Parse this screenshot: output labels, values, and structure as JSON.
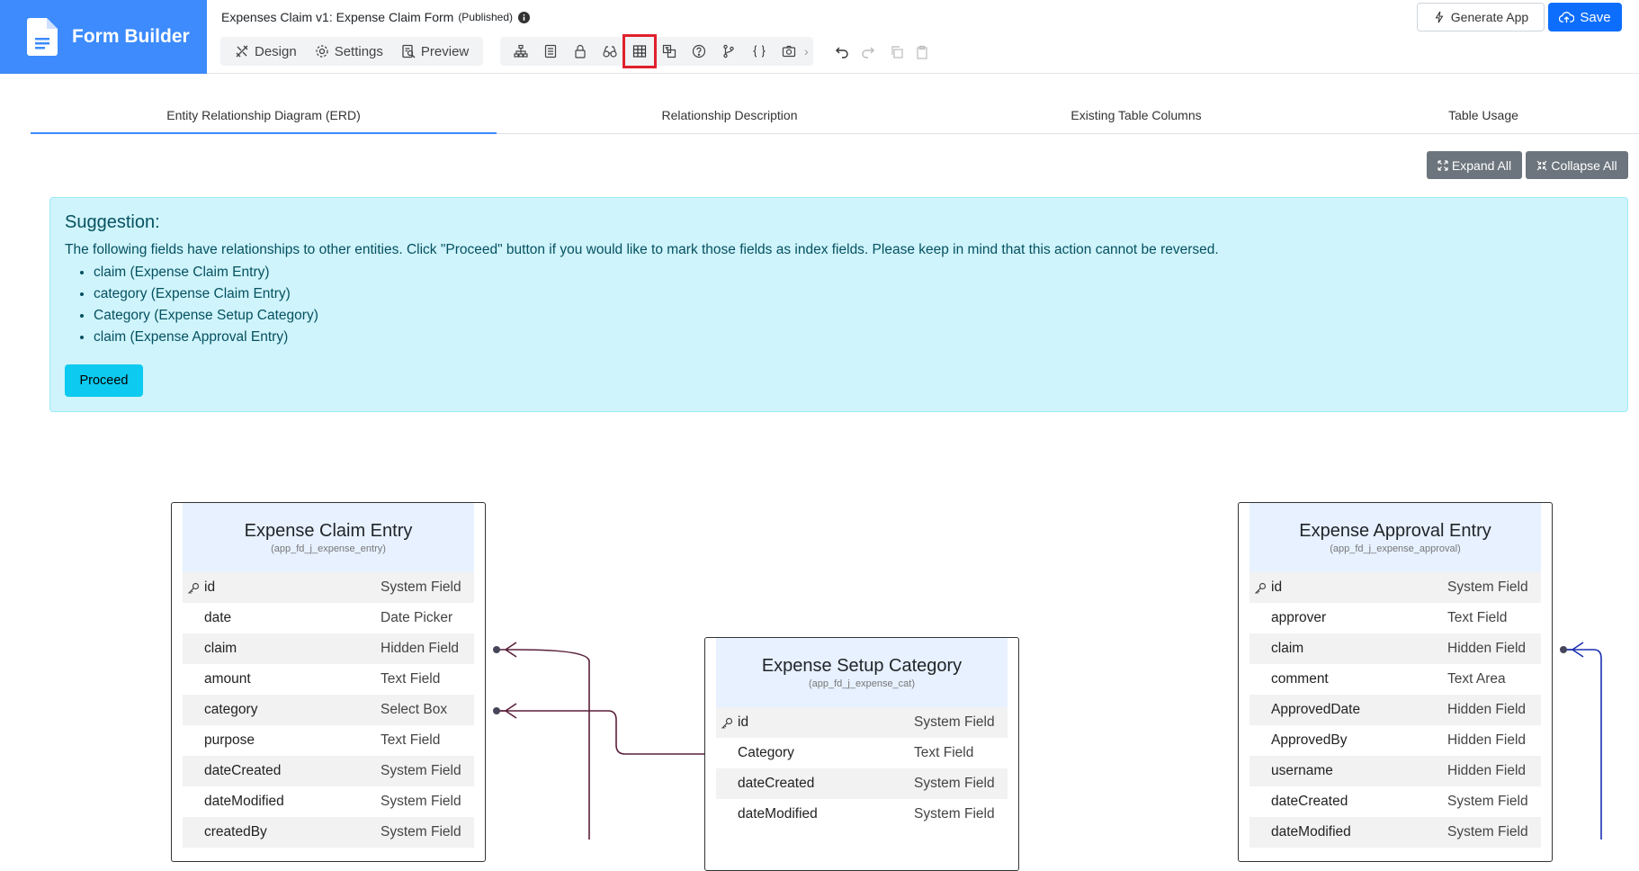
{
  "brand": {
    "name": "Form Builder"
  },
  "form": {
    "title": "Expenses Claim v1: Expense Claim Form",
    "status": "(Published)"
  },
  "modes": [
    {
      "label": "Design",
      "icon": "design-tools-icon"
    },
    {
      "label": "Settings",
      "icon": "gear-icon"
    },
    {
      "label": "Preview",
      "icon": "preview-icon"
    }
  ],
  "toolbar_icons": [
    "sitemap-icon",
    "form-summary-icon",
    "lock-icon",
    "binoculars-icon",
    "table-icon",
    "translate-icon",
    "help-icon",
    "branch-icon",
    "code-braces-icon",
    "camera-icon"
  ],
  "header_actions": {
    "generate_label": "Generate App",
    "save_label": "Save"
  },
  "tabs": [
    {
      "label": "Entity Relationship Diagram (ERD)",
      "active": true
    },
    {
      "label": "Relationship Description",
      "active": false
    },
    {
      "label": "Existing Table Columns",
      "active": false
    },
    {
      "label": "Table Usage",
      "active": false
    }
  ],
  "erd_actions": {
    "expand_label": "Expand All",
    "collapse_label": "Collapse All"
  },
  "suggestion": {
    "heading": "Suggestion:",
    "text": "The following fields have relationships to other entities. Click \"Proceed\" button if you would like to mark those fields as index fields. Please keep in mind that this action cannot be reversed.",
    "items": [
      "claim (Expense Claim Entry)",
      "category (Expense Claim Entry)",
      "Category (Expense Setup Category)",
      "claim (Expense Approval Entry)"
    ],
    "proceed_label": "Proceed"
  },
  "entities": [
    {
      "name": "Expense Claim Entry",
      "table": "(app_fd_j_expense_entry)",
      "fields": [
        {
          "name": "id",
          "type": "System Field",
          "key": true
        },
        {
          "name": "date",
          "type": "Date Picker"
        },
        {
          "name": "claim",
          "type": "Hidden Field"
        },
        {
          "name": "amount",
          "type": "Text Field"
        },
        {
          "name": "category",
          "type": "Select Box"
        },
        {
          "name": "purpose",
          "type": "Text Field"
        },
        {
          "name": "dateCreated",
          "type": "System Field"
        },
        {
          "name": "dateModified",
          "type": "System Field"
        },
        {
          "name": "createdBy",
          "type": "System Field"
        }
      ]
    },
    {
      "name": "Expense Setup Category",
      "table": "(app_fd_j_expense_cat)",
      "fields": [
        {
          "name": "id",
          "type": "System Field",
          "key": true
        },
        {
          "name": "Category",
          "type": "Text Field"
        },
        {
          "name": "dateCreated",
          "type": "System Field"
        },
        {
          "name": "dateModified",
          "type": "System Field"
        }
      ]
    },
    {
      "name": "Expense Approval Entry",
      "table": "(app_fd_j_expense_approval)",
      "fields": [
        {
          "name": "id",
          "type": "System Field",
          "key": true
        },
        {
          "name": "approver",
          "type": "Text Field"
        },
        {
          "name": "claim",
          "type": "Hidden Field"
        },
        {
          "name": "comment",
          "type": "Text Area"
        },
        {
          "name": "ApprovedDate",
          "type": "Hidden Field"
        },
        {
          "name": "ApprovedBy",
          "type": "Hidden Field"
        },
        {
          "name": "username",
          "type": "Hidden Field"
        },
        {
          "name": "dateCreated",
          "type": "System Field"
        },
        {
          "name": "dateModified",
          "type": "System Field"
        }
      ]
    }
  ],
  "colors": {
    "brand": "#3d8bfd",
    "primary": "#0d6efd",
    "suggestion_bg": "#cff4fc",
    "proceed": "#0dcaf0",
    "highlight": "#e0212d",
    "relation_dark": "#5a1f3a",
    "relation_blue": "#1a2fb0"
  }
}
